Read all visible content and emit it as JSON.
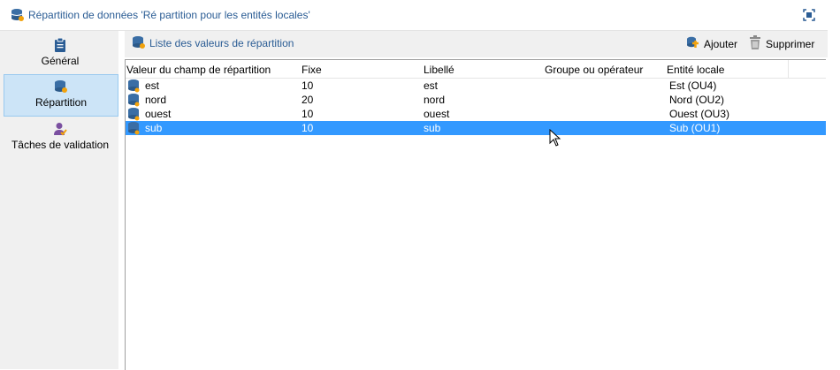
{
  "window": {
    "title": "Répartition de données 'Ré partition pour les entités locales'"
  },
  "sidebar": {
    "items": [
      {
        "label": "Général",
        "icon": "clipboard-icon"
      },
      {
        "label": "Répartition",
        "icon": "database-user-icon"
      },
      {
        "label": "Tâches de validation",
        "icon": "user-check-icon"
      }
    ]
  },
  "toolbar": {
    "title": "Liste des valeurs de répartition",
    "add_label": "Ajouter",
    "delete_label": "Supprimer"
  },
  "table": {
    "columns": [
      "Valeur du champ de répartition",
      "Fixe",
      "Libellé",
      "Groupe ou opérateur",
      "Entité locale"
    ],
    "rows": [
      {
        "value": "est",
        "fixe": "10",
        "libelle": "est",
        "groupe": "",
        "entite": "Est (OU4)"
      },
      {
        "value": "nord",
        "fixe": "20",
        "libelle": "nord",
        "groupe": "",
        "entite": "Nord (OU2)"
      },
      {
        "value": "ouest",
        "fixe": "10",
        "libelle": "ouest",
        "groupe": "",
        "entite": "Ouest (OU3)"
      },
      {
        "value": "sub",
        "fixe": "10",
        "libelle": "sub",
        "groupe": "",
        "entite": "Sub (OU1)"
      }
    ],
    "selected_row": 3
  },
  "colors": {
    "accent": "#2a5c94",
    "selection": "#3399ff",
    "active_tab": "#cce4f7"
  }
}
